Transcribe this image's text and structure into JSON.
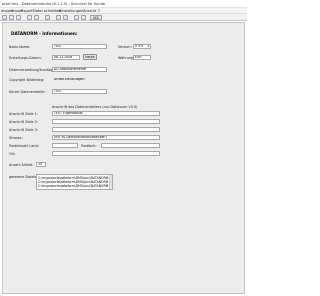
{
  "window": {
    "title": "pixel.dnx - Datanormstudio (6.1.2.5) - Schnüfel für Kunde"
  },
  "menu": [
    "Import",
    "Import",
    "Export",
    "Datei schreiben",
    "Einstellungen",
    "Ansicht",
    "?"
  ],
  "toolbar": {
    "vdi_label": "VDi"
  },
  "section_title": "DATANORM - Informationen:",
  "fields": {
    "basis_name_label": "Basis-Name:",
    "basis_name_value": "TEST",
    "version_label": "Version:",
    "version_value": "V 5.0",
    "erstellung_label": "Erstellungs-Datum:",
    "erstellung_value": "08.11.2008",
    "heute_button": "heute",
    "waehrung_label": "Währung:",
    "waehrung_value": "EUR",
    "datenhaltung_label": "Datenverwaltung/Kurztag:",
    "datenhaltung_value": "AG Arbeitselemente",
    "copyright_label": "Copyright Bilderbeg:",
    "copyright_value": "Artikel-Neuanlagen",
    "kurzel_label": "Kürzel Datenersteller:",
    "kurzel_value": "TEST",
    "anschrift_heading": "Anschrift des Datenerstellers (nur Datanorm V3.0)",
    "anschrift1_label": "Anschrift Zeile 1:",
    "anschrift1_value": "TEST Fugenkontor",
    "anschrift2_label": "Anschrift Zeile 2:",
    "anschrift2_value": "",
    "anschrift3_label": "Anschrift Zeile 3:",
    "anschrift3_value": "",
    "strasse_label": "Strasse:",
    "strasse_value": "(nur zu Demonstrationszwecken)",
    "plz_label": "Postleitzahl Land:",
    "plz_value": "",
    "postfach_label": "Postfach:",
    "postfach_value": "",
    "ort_label": "Ort:",
    "ort_value": "",
    "artikel_label": "Anzahl Artikel:",
    "artikel_value": "35",
    "dateien_label": "gelesene Dateien:",
    "dateien": [
      "C:\\myprojects\\dataform\\DMG\\pixi\\DATANORM.001",
      "C:\\myprojects\\dataform\\DMG\\pixi\\DATANORM.002",
      "C:\\myprojects\\dataform\\DMG\\pixi\\DATANORM.003"
    ]
  }
}
